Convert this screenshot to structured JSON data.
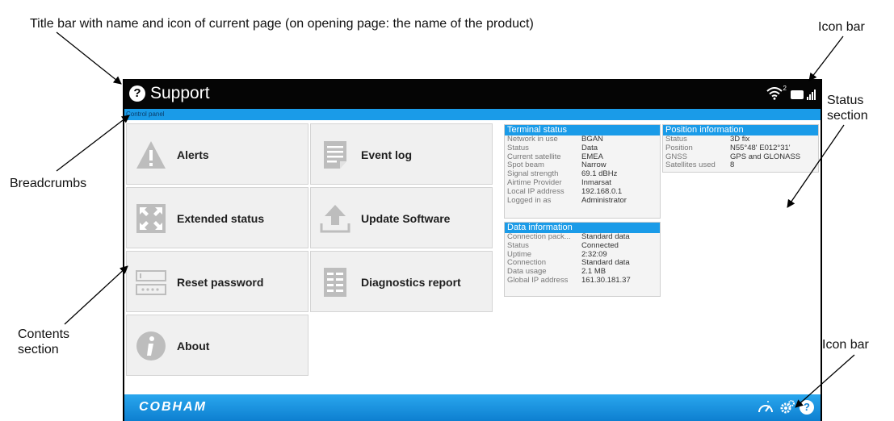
{
  "annotations": {
    "title_bar": "Title bar with name and icon of current page (on opening page: the name of the product)",
    "icon_bar_top": "Icon bar",
    "status_section_line1": "Status",
    "status_section_line2": "section",
    "breadcrumbs": "Breadcrumbs",
    "contents_line1": "Contents",
    "contents_line2": "section",
    "icon_bar_bottom": "Icon bar"
  },
  "titlebar": {
    "title": "Support",
    "icon": "question-circle-icon"
  },
  "status_icons": {
    "signal_badge": "2"
  },
  "breadcrumb": "Control panel",
  "tiles": [
    {
      "label": "Alerts",
      "icon": "warning-icon"
    },
    {
      "label": "Event log",
      "icon": "document-icon"
    },
    {
      "label": "Extended status",
      "icon": "expand-icon"
    },
    {
      "label": "Update Software",
      "icon": "upload-icon"
    },
    {
      "label": "Reset password",
      "icon": "password-field-icon"
    },
    {
      "label": "Diagnostics report",
      "icon": "report-icon"
    },
    {
      "label": "About",
      "icon": "info-icon"
    }
  ],
  "terminal_status": {
    "title": "Terminal status",
    "rows": [
      {
        "k": "Network in use",
        "v": "BGAN"
      },
      {
        "k": "Status",
        "v": "Data"
      },
      {
        "k": "Current satellite",
        "v": "EMEA"
      },
      {
        "k": "Spot beam",
        "v": "Narrow"
      },
      {
        "k": "Signal strength",
        "v": "69.1 dBHz"
      },
      {
        "k": "Airtime Provider",
        "v": "Inmarsat"
      },
      {
        "k": "Local IP address",
        "v": "192.168.0.1"
      },
      {
        "k": "Logged in as",
        "v": "Administrator"
      }
    ]
  },
  "data_information": {
    "title": "Data information",
    "rows": [
      {
        "k": "Connection pack...",
        "v": "Standard data"
      },
      {
        "k": "Status",
        "v": "Connected"
      },
      {
        "k": "Uptime",
        "v": "2:32:09"
      },
      {
        "k": "Connection",
        "v": "Standard data"
      },
      {
        "k": "Data usage",
        "v": "2.1 MB"
      },
      {
        "k": "Global IP address",
        "v": "161.30.181.37"
      }
    ]
  },
  "position_information": {
    "title": "Position information",
    "rows": [
      {
        "k": "Status",
        "v": "3D fix"
      },
      {
        "k": "Position",
        "v": "N55°48' E012°31'"
      },
      {
        "k": "GNSS",
        "v": "GPS and GLONASS"
      },
      {
        "k": "Satellites used",
        "v": "8"
      }
    ]
  },
  "footer": {
    "brand": "COBHAM"
  },
  "colors": {
    "accent": "#1a9be8",
    "titlebar": "#050505",
    "tile_bg": "#f0f0f0"
  }
}
